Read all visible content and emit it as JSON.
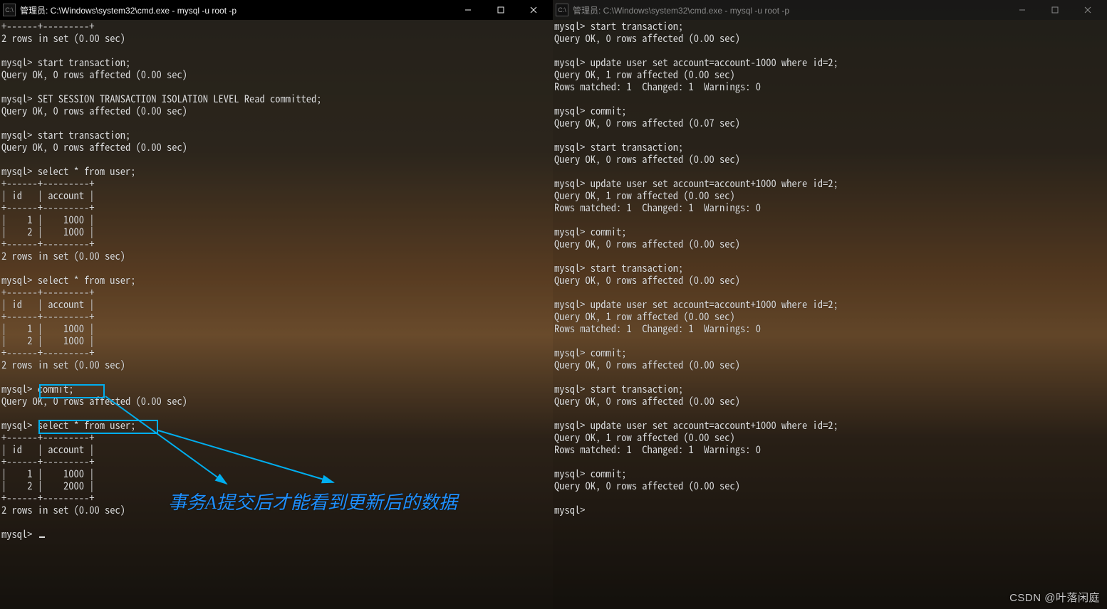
{
  "left": {
    "title": "管理员: C:\\Windows\\system32\\cmd.exe - mysql  -u root -p",
    "lines": [
      "+------+---------+",
      "2 rows in set (0.00 sec)",
      "",
      "mysql> start transaction;",
      "Query OK, 0 rows affected (0.00 sec)",
      "",
      "mysql> SET SESSION TRANSACTION ISOLATION LEVEL Read committed;",
      "Query OK, 0 rows affected (0.00 sec)",
      "",
      "mysql> start transaction;",
      "Query OK, 0 rows affected (0.00 sec)",
      "",
      "mysql> select * from user;",
      "+------+---------+",
      "| id   | account |",
      "+------+---------+",
      "|    1 |    1000 |",
      "|    2 |    1000 |",
      "+------+---------+",
      "2 rows in set (0.00 sec)",
      "",
      "mysql> select * from user;",
      "+------+---------+",
      "| id   | account |",
      "+------+---------+",
      "|    1 |    1000 |",
      "|    2 |    1000 |",
      "+------+---------+",
      "2 rows in set (0.00 sec)",
      "",
      "mysql> commit;",
      "Query OK, 0 rows affected (0.00 sec)",
      "",
      "mysql> select * from user;",
      "+------+---------+",
      "| id   | account |",
      "+------+---------+",
      "|    1 |    1000 |",
      "|    2 |    2000 |",
      "+------+---------+",
      "2 rows in set (0.00 sec)",
      "",
      "mysql> "
    ]
  },
  "right": {
    "title": "管理员: C:\\Windows\\system32\\cmd.exe - mysql  -u root -p",
    "lines": [
      "mysql> start transaction;",
      "Query OK, 0 rows affected (0.00 sec)",
      "",
      "mysql> update user set account=account-1000 where id=2;",
      "Query OK, 1 row affected (0.00 sec)",
      "Rows matched: 1  Changed: 1  Warnings: 0",
      "",
      "mysql> commit;",
      "Query OK, 0 rows affected (0.07 sec)",
      "",
      "mysql> start transaction;",
      "Query OK, 0 rows affected (0.00 sec)",
      "",
      "mysql> update user set account=account+1000 where id=2;",
      "Query OK, 1 row affected (0.00 sec)",
      "Rows matched: 1  Changed: 1  Warnings: 0",
      "",
      "mysql> commit;",
      "Query OK, 0 rows affected (0.00 sec)",
      "",
      "mysql> start transaction;",
      "Query OK, 0 rows affected (0.00 sec)",
      "",
      "mysql> update user set account=account+1000 where id=2;",
      "Query OK, 1 row affected (0.00 sec)",
      "Rows matched: 1  Changed: 1  Warnings: 0",
      "",
      "mysql> commit;",
      "Query OK, 0 rows affected (0.00 sec)",
      "",
      "mysql> start transaction;",
      "Query OK, 0 rows affected (0.00 sec)",
      "",
      "mysql> update user set account=account+1000 where id=2;",
      "Query OK, 1 row affected (0.00 sec)",
      "Rows matched: 1  Changed: 1  Warnings: 0",
      "",
      "mysql> commit;",
      "Query OK, 0 rows affected (0.00 sec)",
      "",
      "mysql>"
    ]
  },
  "annotation": "事务A提交后才能看到更新后的数据",
  "watermark": "CSDN @叶落闲庭",
  "icon_label": "C:\\"
}
